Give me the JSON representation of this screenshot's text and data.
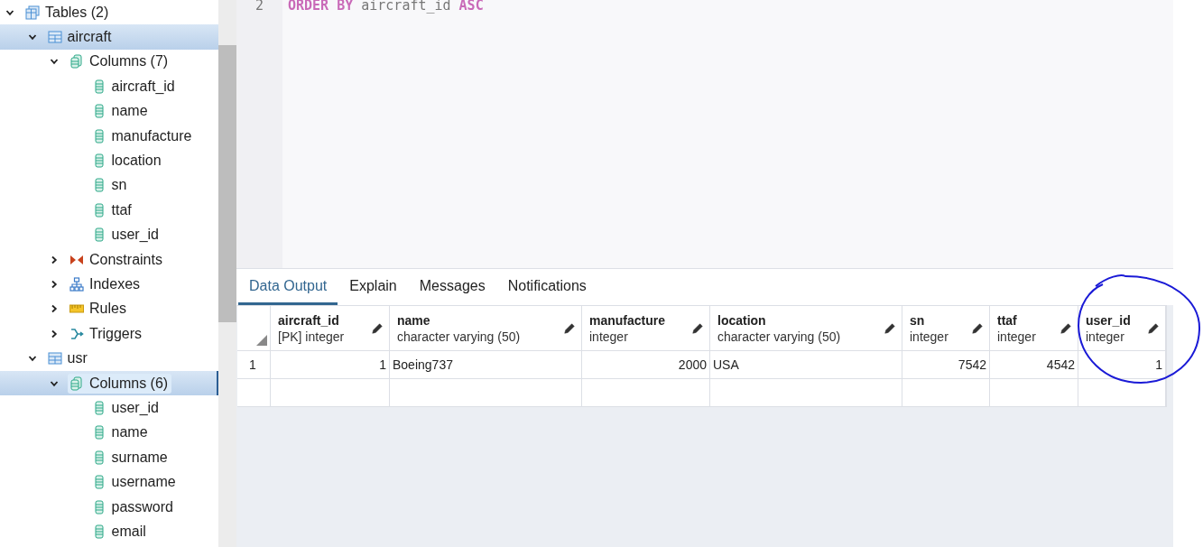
{
  "tree": [
    {
      "label": "Tables (2)",
      "kind": "table-group",
      "expanded": true,
      "selected": false,
      "children": [
        {
          "label": "aircraft",
          "kind": "table",
          "expanded": true,
          "selected": true,
          "children": [
            {
              "label": "Columns (7)",
              "kind": "columns",
              "expanded": true,
              "selected": false,
              "children": [
                {
                  "label": "aircraft_id",
                  "kind": "column",
                  "selected": false
                },
                {
                  "label": "name",
                  "kind": "column",
                  "selected": false
                },
                {
                  "label": "manufacture",
                  "kind": "column",
                  "selected": false
                },
                {
                  "label": "location",
                  "kind": "column",
                  "selected": false
                },
                {
                  "label": "sn",
                  "kind": "column",
                  "selected": false
                },
                {
                  "label": "ttaf",
                  "kind": "column",
                  "selected": false
                },
                {
                  "label": "user_id",
                  "kind": "column",
                  "selected": false
                }
              ]
            },
            {
              "label": "Constraints",
              "kind": "constraints",
              "expanded": false,
              "selected": false
            },
            {
              "label": "Indexes",
              "kind": "indexes",
              "expanded": false,
              "selected": false
            },
            {
              "label": "Rules",
              "kind": "rules",
              "expanded": false,
              "selected": false
            },
            {
              "label": "Triggers",
              "kind": "triggers",
              "expanded": false,
              "selected": false
            }
          ]
        },
        {
          "label": "usr",
          "kind": "table",
          "expanded": true,
          "selected": false,
          "children": [
            {
              "label": "Columns (6)",
              "kind": "columns",
              "expanded": true,
              "selected": true,
              "focused": true,
              "children": [
                {
                  "label": "user_id",
                  "kind": "column",
                  "selected": false
                },
                {
                  "label": "name",
                  "kind": "column",
                  "selected": false
                },
                {
                  "label": "surname",
                  "kind": "column",
                  "selected": false
                },
                {
                  "label": "username",
                  "kind": "column",
                  "selected": false
                },
                {
                  "label": "password",
                  "kind": "column",
                  "selected": false
                },
                {
                  "label": "email",
                  "kind": "column",
                  "selected": false
                }
              ]
            }
          ]
        }
      ]
    }
  ],
  "editor": {
    "line_number": "2",
    "tokens": [
      {
        "text": "ORDER BY",
        "kind": "keyword"
      },
      {
        "text": "aircraft_id",
        "kind": "identifier"
      },
      {
        "text": "ASC",
        "kind": "keyword"
      }
    ]
  },
  "tabs": [
    {
      "label": "Data Output",
      "selected": true
    },
    {
      "label": "Explain",
      "selected": false
    },
    {
      "label": "Messages",
      "selected": false
    },
    {
      "label": "Notifications",
      "selected": false
    }
  ],
  "table": {
    "columns": [
      {
        "name": "aircraft_id",
        "type": "[PK] integer",
        "kind": "number"
      },
      {
        "name": "name",
        "type": "character varying (50)",
        "kind": "text"
      },
      {
        "name": "manufacture",
        "type": "integer",
        "kind": "number"
      },
      {
        "name": "location",
        "type": "character varying (50)",
        "kind": "text"
      },
      {
        "name": "sn",
        "type": "integer",
        "kind": "number"
      },
      {
        "name": "ttaf",
        "type": "integer",
        "kind": "number"
      },
      {
        "name": "user_id",
        "type": "integer",
        "kind": "number"
      }
    ],
    "rows": [
      {
        "number": "1",
        "cells": [
          "1",
          "Boeing737",
          "2000",
          "USA",
          "7542",
          "4542",
          "1"
        ]
      }
    ]
  }
}
